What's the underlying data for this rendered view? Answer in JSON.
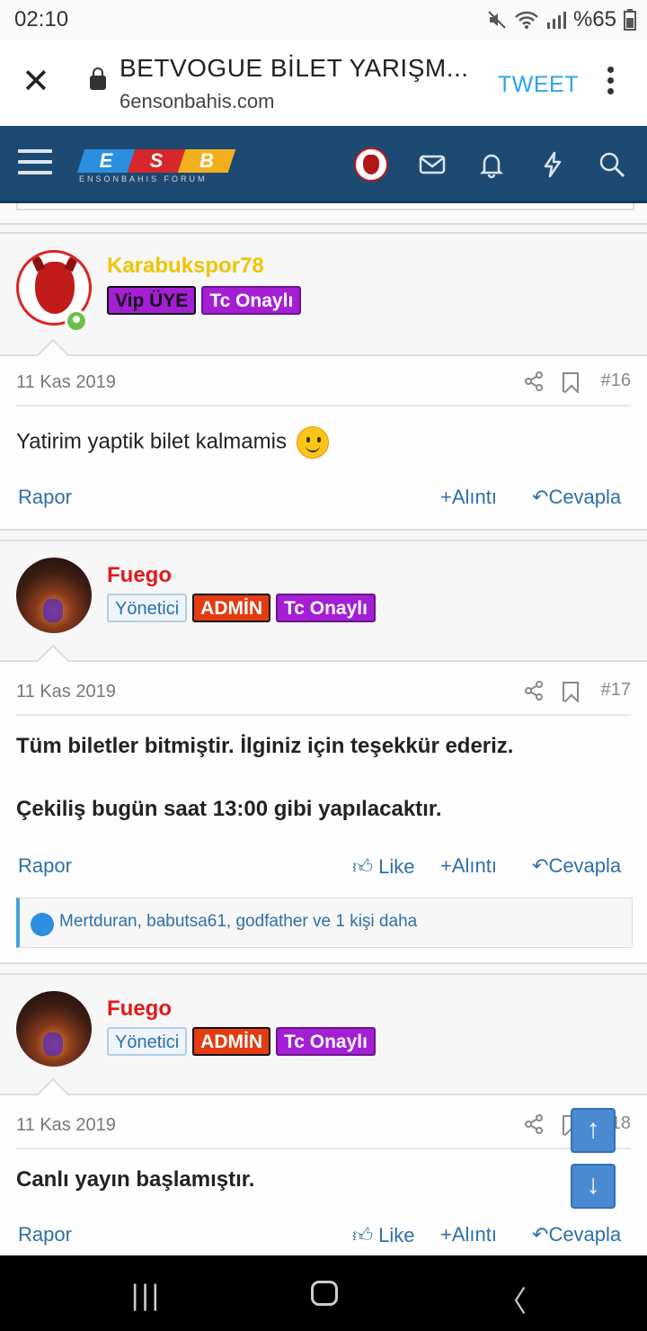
{
  "status": {
    "time": "02:10",
    "battery": "%65"
  },
  "browser": {
    "title": "BETVOGUE BİLET YARIŞM...",
    "domain": "6ensonbahis.com",
    "tweet_label": "TWEET"
  },
  "site": {
    "logo_letters": [
      "E",
      "S",
      "B"
    ],
    "logo_sub": "ENSONBAHIS FORUM"
  },
  "posts": [
    {
      "username": "Karabukspor78",
      "username_color": "#f0c400",
      "badges": [
        "Vip ÜYE",
        "Tc Onaylı"
      ],
      "date": "11 Kas 2019",
      "number": "#16",
      "body": [
        "Yatirim yaptik bilet kalmamis"
      ],
      "actions": {
        "report": "Rapor",
        "quote": "Alıntı",
        "reply": "Cevapla"
      }
    },
    {
      "username": "Fuego",
      "username_color": "#e11a1a",
      "badges": [
        "Yönetici",
        "ADMİN",
        "Tc Onaylı"
      ],
      "date": "11 Kas 2019",
      "number": "#17",
      "body": [
        "Tüm biletler bitmiştir. İlginiz için teşekkür ederiz.",
        "Çekiliş bugün saat 13:00 gibi yapılacaktır."
      ],
      "actions": {
        "report": "Rapor",
        "like": "Like",
        "quote": "Alıntı",
        "reply": "Cevapla"
      },
      "reactions": "Mertduran, babutsa61, godfather ve 1 kişi daha"
    },
    {
      "username": "Fuego",
      "username_color": "#e11a1a",
      "badges": [
        "Yönetici",
        "ADMİN",
        "Tc Onaylı"
      ],
      "date": "11 Kas 2019",
      "number": "#18",
      "body": [
        "Canlı yayın başlamıştır."
      ],
      "actions": {
        "report": "Rapor",
        "like": "Like",
        "quote": "Alıntı",
        "reply": "Cevapla"
      }
    }
  ],
  "colors": {
    "nav": "#1d4a73",
    "link": "#2f6fa8",
    "vip": "#a41fd4",
    "admin": "#e23c10"
  }
}
